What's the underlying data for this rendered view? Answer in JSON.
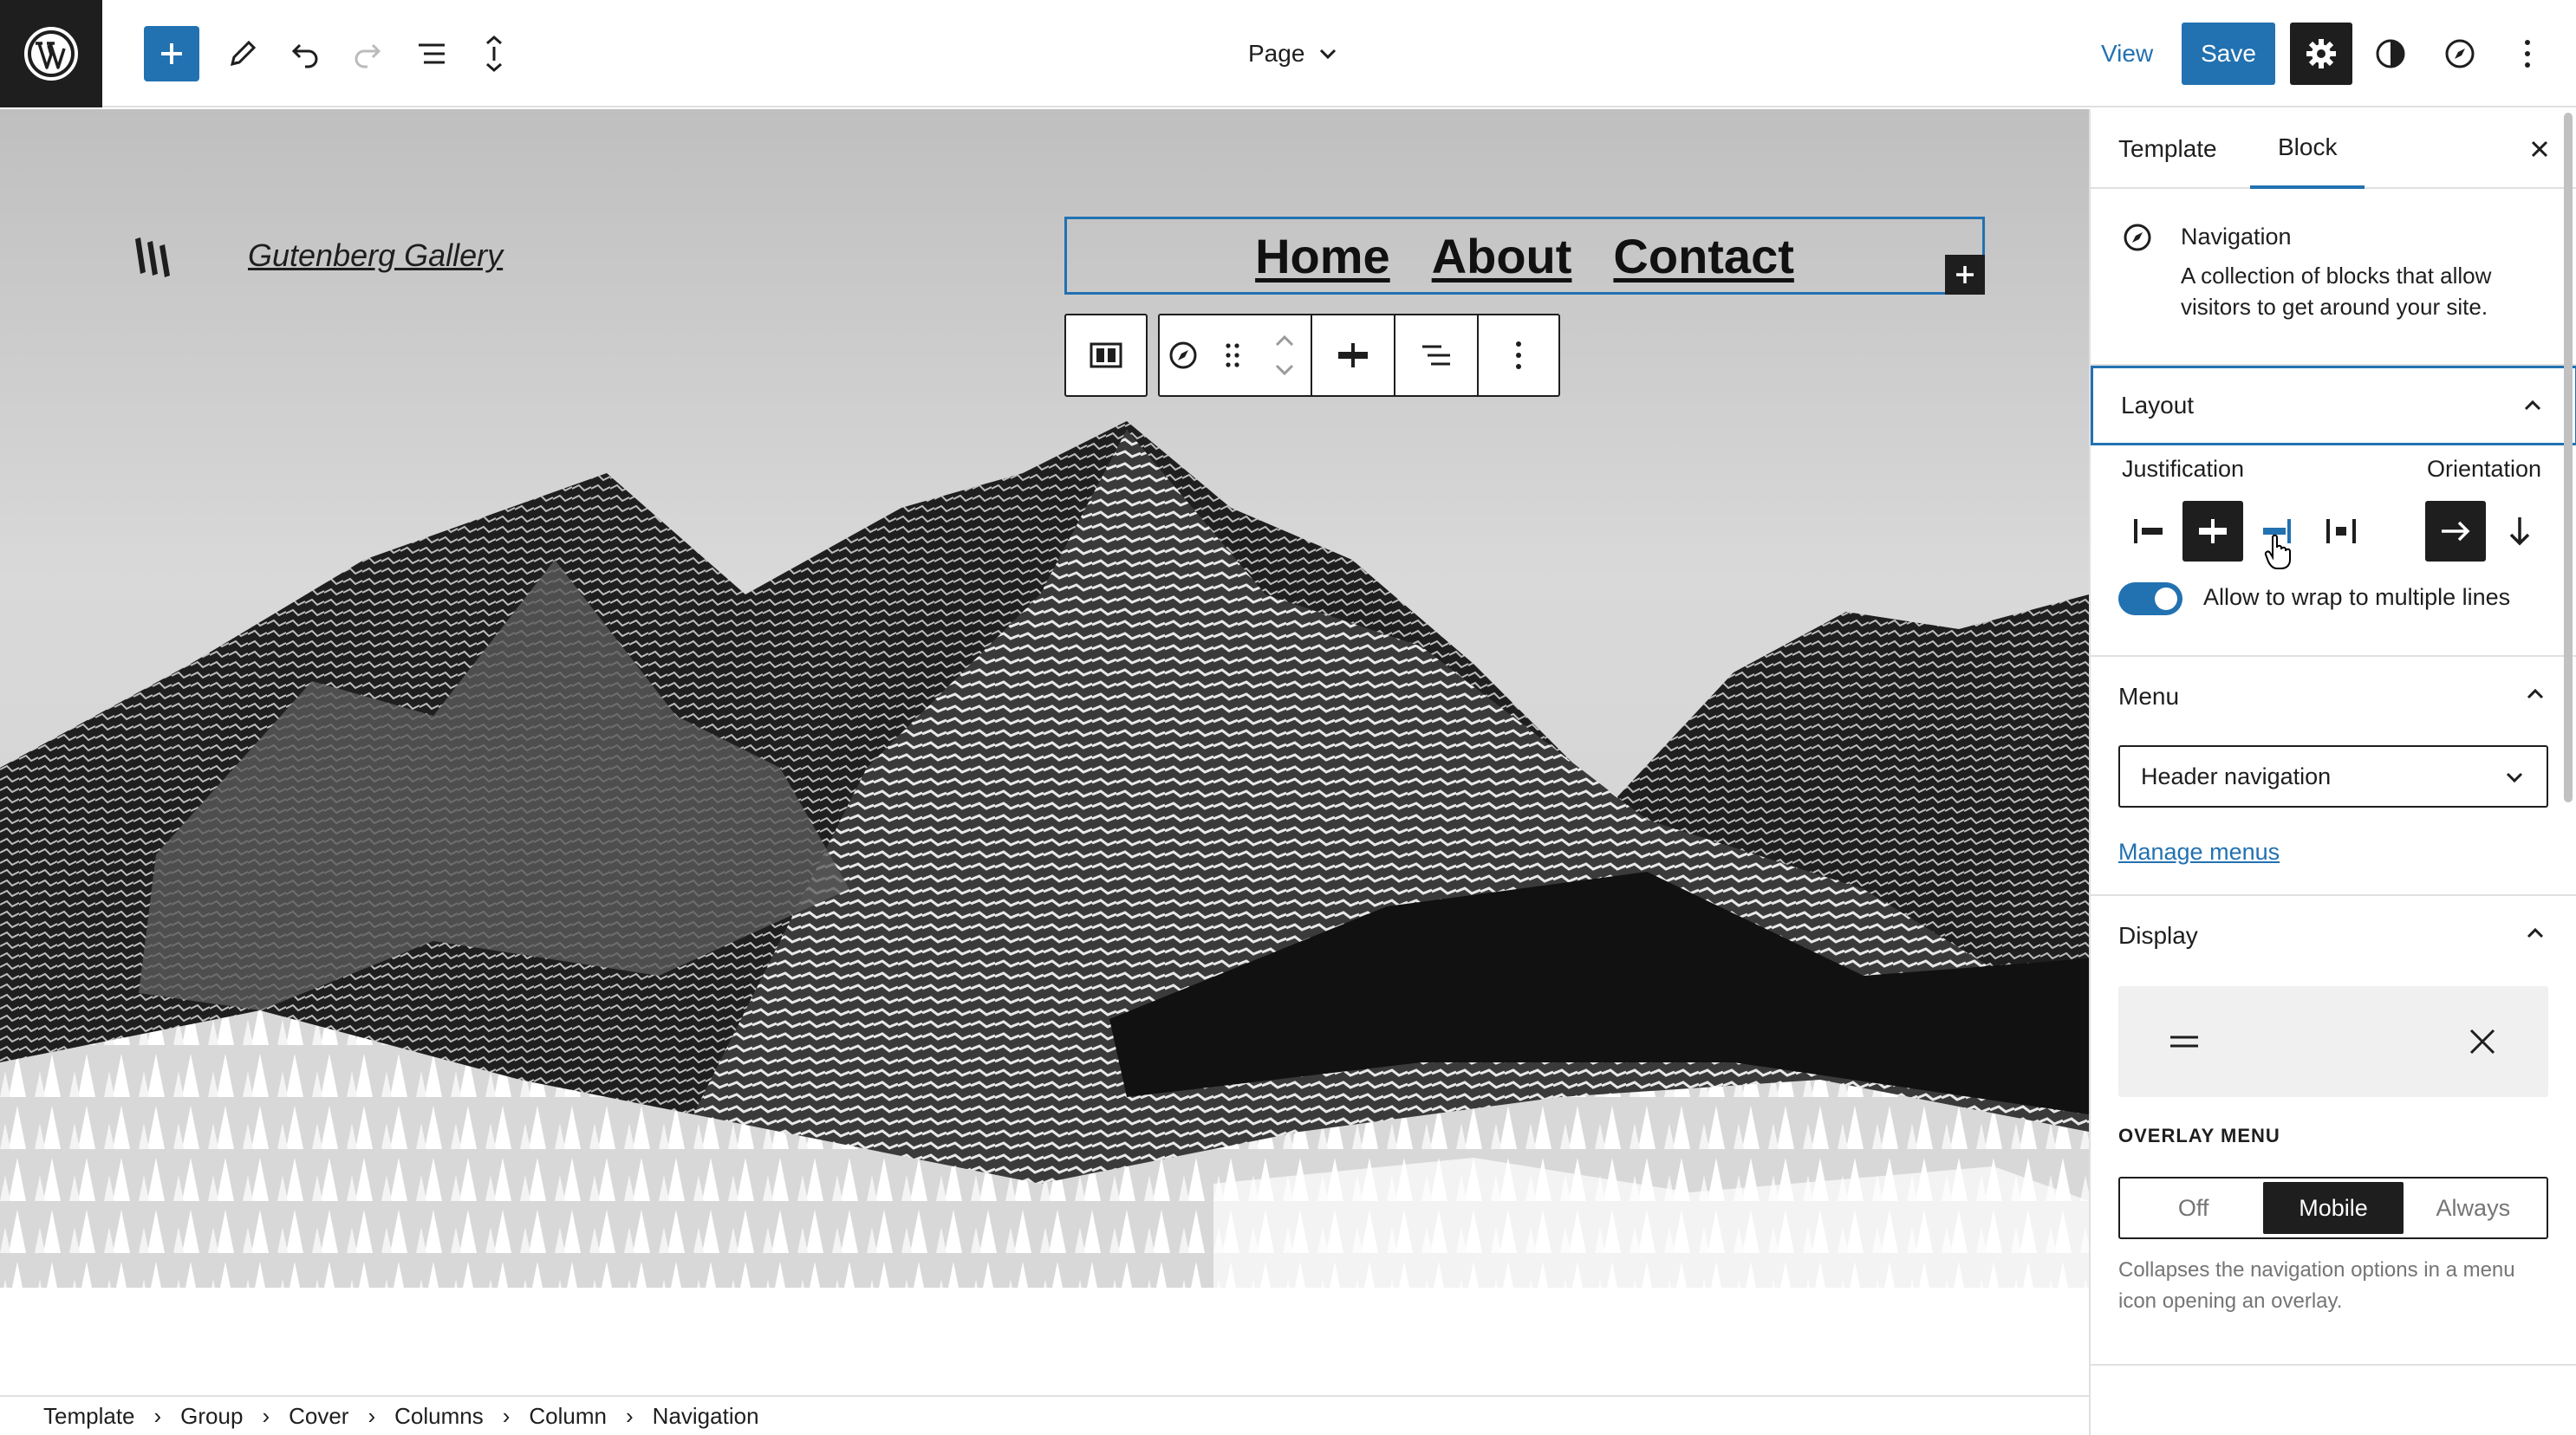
{
  "topbar": {
    "logo_icon": "wordpress-logo-icon",
    "inserter_icon": "plus-icon",
    "tool_icons": [
      "pencil-icon",
      "undo-icon",
      "redo-icon",
      "list-view-icon",
      "document-overview-icon"
    ],
    "document_title": "Page",
    "view_label": "View",
    "save_label": "Save",
    "right_icons": [
      "gear-icon",
      "styles-half-circle-icon",
      "compass-icon",
      "more-vertical-icon"
    ]
  },
  "canvas": {
    "site_title": "Gutenberg Gallery",
    "nav_links": [
      "Home",
      "About",
      "Contact"
    ],
    "block_toolbar_icons": [
      "parent-columns-icon",
      "navigation-compass-icon",
      "drag-handle-icon",
      "move-up-down-icon",
      "justify-center-icon",
      "align-text-icon",
      "more-vertical-icon"
    ]
  },
  "breadcrumb": [
    "Template",
    "Group",
    "Cover",
    "Columns",
    "Column",
    "Navigation"
  ],
  "sidebar": {
    "tabs": [
      "Template",
      "Block"
    ],
    "active_tab": "Block",
    "block": {
      "title": "Navigation",
      "description": "A collection of blocks that allow visitors to get around your site."
    },
    "layout": {
      "heading": "Layout",
      "justification_label": "Justification",
      "orientation_label": "Orientation",
      "justification_options": [
        "justify-left-icon",
        "justify-center-icon",
        "justify-right-icon",
        "justify-space-between-icon"
      ],
      "justification_selected": "justify-center-icon",
      "orientation_options": [
        "arrow-right-icon",
        "arrow-down-icon"
      ],
      "orientation_selected": "arrow-right-icon",
      "wrap_label": "Allow to wrap to multiple lines",
      "wrap_enabled": true
    },
    "menu": {
      "heading": "Menu",
      "selected": "Header navigation",
      "manage_label": "Manage menus"
    },
    "display": {
      "heading": "Display",
      "overlay_label": "OVERLAY MENU",
      "overlay_options": [
        "Off",
        "Mobile",
        "Always"
      ],
      "overlay_selected": "Mobile",
      "help": "Collapses the navigation options in a menu icon opening an overlay."
    }
  },
  "colors": {
    "accent": "#2271b1",
    "dark": "#1e1e1e",
    "muted": "#757575",
    "border": "#e0e0e0"
  }
}
